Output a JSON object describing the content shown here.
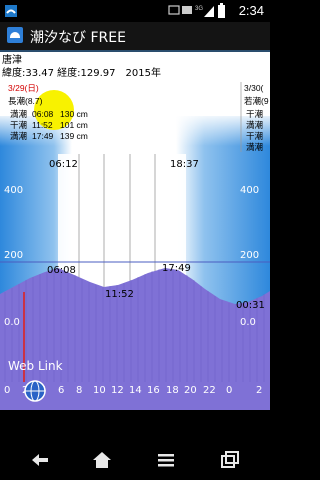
{
  "status_bar": {
    "time": "2:34",
    "icons": [
      "app-notification-icon",
      "sms-icon",
      "usb-icon",
      "3g-icon",
      "signal-icon",
      "battery-icon"
    ]
  },
  "app_bar": {
    "title": "潮汐なび FREE",
    "icon": "app-icon"
  },
  "location": {
    "name": "唐津",
    "coords_line": "緯度:33.47 経度:129.97　2015年"
  },
  "day1": {
    "date": "3/29(日)",
    "tide_type": "長潮(8.7)",
    "rows": [
      {
        "label": "満潮",
        "time": "06:08",
        "height": "130 cm"
      },
      {
        "label": "干潮",
        "time": "11:52",
        "height": "101 cm"
      },
      {
        "label": "満潮",
        "time": "17:49",
        "height": "139 cm"
      }
    ]
  },
  "day2": {
    "date": "3/30(",
    "tide_type": "若潮(9",
    "rows": [
      {
        "label": "干潮"
      },
      {
        "label": "満潮"
      },
      {
        "label": "干潮"
      },
      {
        "label": "満潮"
      }
    ]
  },
  "sun_times": {
    "sunrise": "06:12",
    "sunset": "18:37"
  },
  "y_axis": {
    "labels": [
      "400",
      "200",
      "0.0"
    ]
  },
  "tide_labels": {
    "high1": "06:08",
    "low1": "11:52",
    "high2": "17:49",
    "next_low": "00:31"
  },
  "x_axis": {
    "ticks": [
      "0",
      "2",
      "4",
      "6",
      "8",
      "10",
      "12",
      "14",
      "16",
      "18",
      "20",
      "22",
      "0",
      "2"
    ]
  },
  "web_link": {
    "label": "Web Link",
    "icon": "globe-icon"
  },
  "nav_bar": {
    "buttons": [
      "back-icon",
      "home-icon",
      "menu-icon",
      "recent-apps-icon"
    ]
  },
  "colors": {
    "tide_fill": "#7f71d6",
    "accent_blue": "#2e7fd8",
    "date_red": "#d40000",
    "current_time_line": "#d22"
  }
}
